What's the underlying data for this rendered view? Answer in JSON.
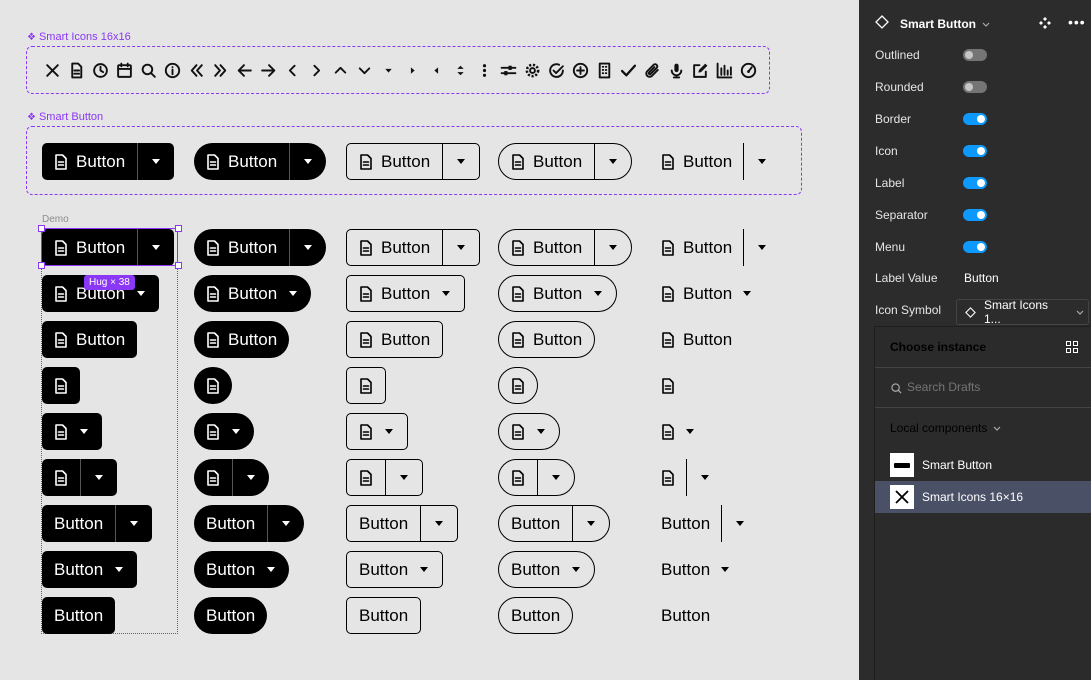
{
  "canvas": {
    "icons_frame_label": "Smart Icons 16x16",
    "button_frame_label": "Smart Button",
    "demo_label": "Demo",
    "hug_badge": "Hug × 38",
    "button_text": "Button",
    "icon_names": [
      "close-icon",
      "document-icon",
      "clock-icon",
      "calendar-icon",
      "search-icon",
      "info-icon",
      "double-chevron-left-icon",
      "double-chevron-right-icon",
      "arrow-left-icon",
      "arrow-right-icon",
      "chevron-left-icon",
      "chevron-right-icon",
      "chevron-up-icon",
      "chevron-down-icon",
      "caret-down-icon",
      "caret-right-icon",
      "caret-left-icon",
      "sort-icon",
      "more-vertical-icon",
      "sliders-icon",
      "settings-icon",
      "check-circle-icon",
      "plus-circle-icon",
      "building-icon",
      "check-icon",
      "paperclip-icon",
      "microphone-icon",
      "edit-icon",
      "chart-icon",
      "gauge-icon"
    ],
    "accent_color": "#8a38f5"
  },
  "panel": {
    "component_name": "Smart Button",
    "properties": [
      {
        "label": "Outlined",
        "on": false
      },
      {
        "label": "Rounded",
        "on": false
      },
      {
        "label": "Border",
        "on": true
      },
      {
        "label": "Icon",
        "on": true
      },
      {
        "label": "Label",
        "on": true
      },
      {
        "label": "Separator",
        "on": true
      },
      {
        "label": "Menu",
        "on": true
      }
    ],
    "label_value_label": "Label Value",
    "label_value": "Button",
    "icon_symbol_label": "Icon Symbol",
    "icon_symbol_value": "Smart Icons 1...",
    "toggle_on_color": "#0d99ff"
  },
  "popup": {
    "title": "Choose instance",
    "search_placeholder": "Search Drafts",
    "section_label": "Local components",
    "items": [
      {
        "label": "Smart Button"
      },
      {
        "label": "Smart Icons 16×16"
      }
    ],
    "active_color": "#4a5066"
  }
}
